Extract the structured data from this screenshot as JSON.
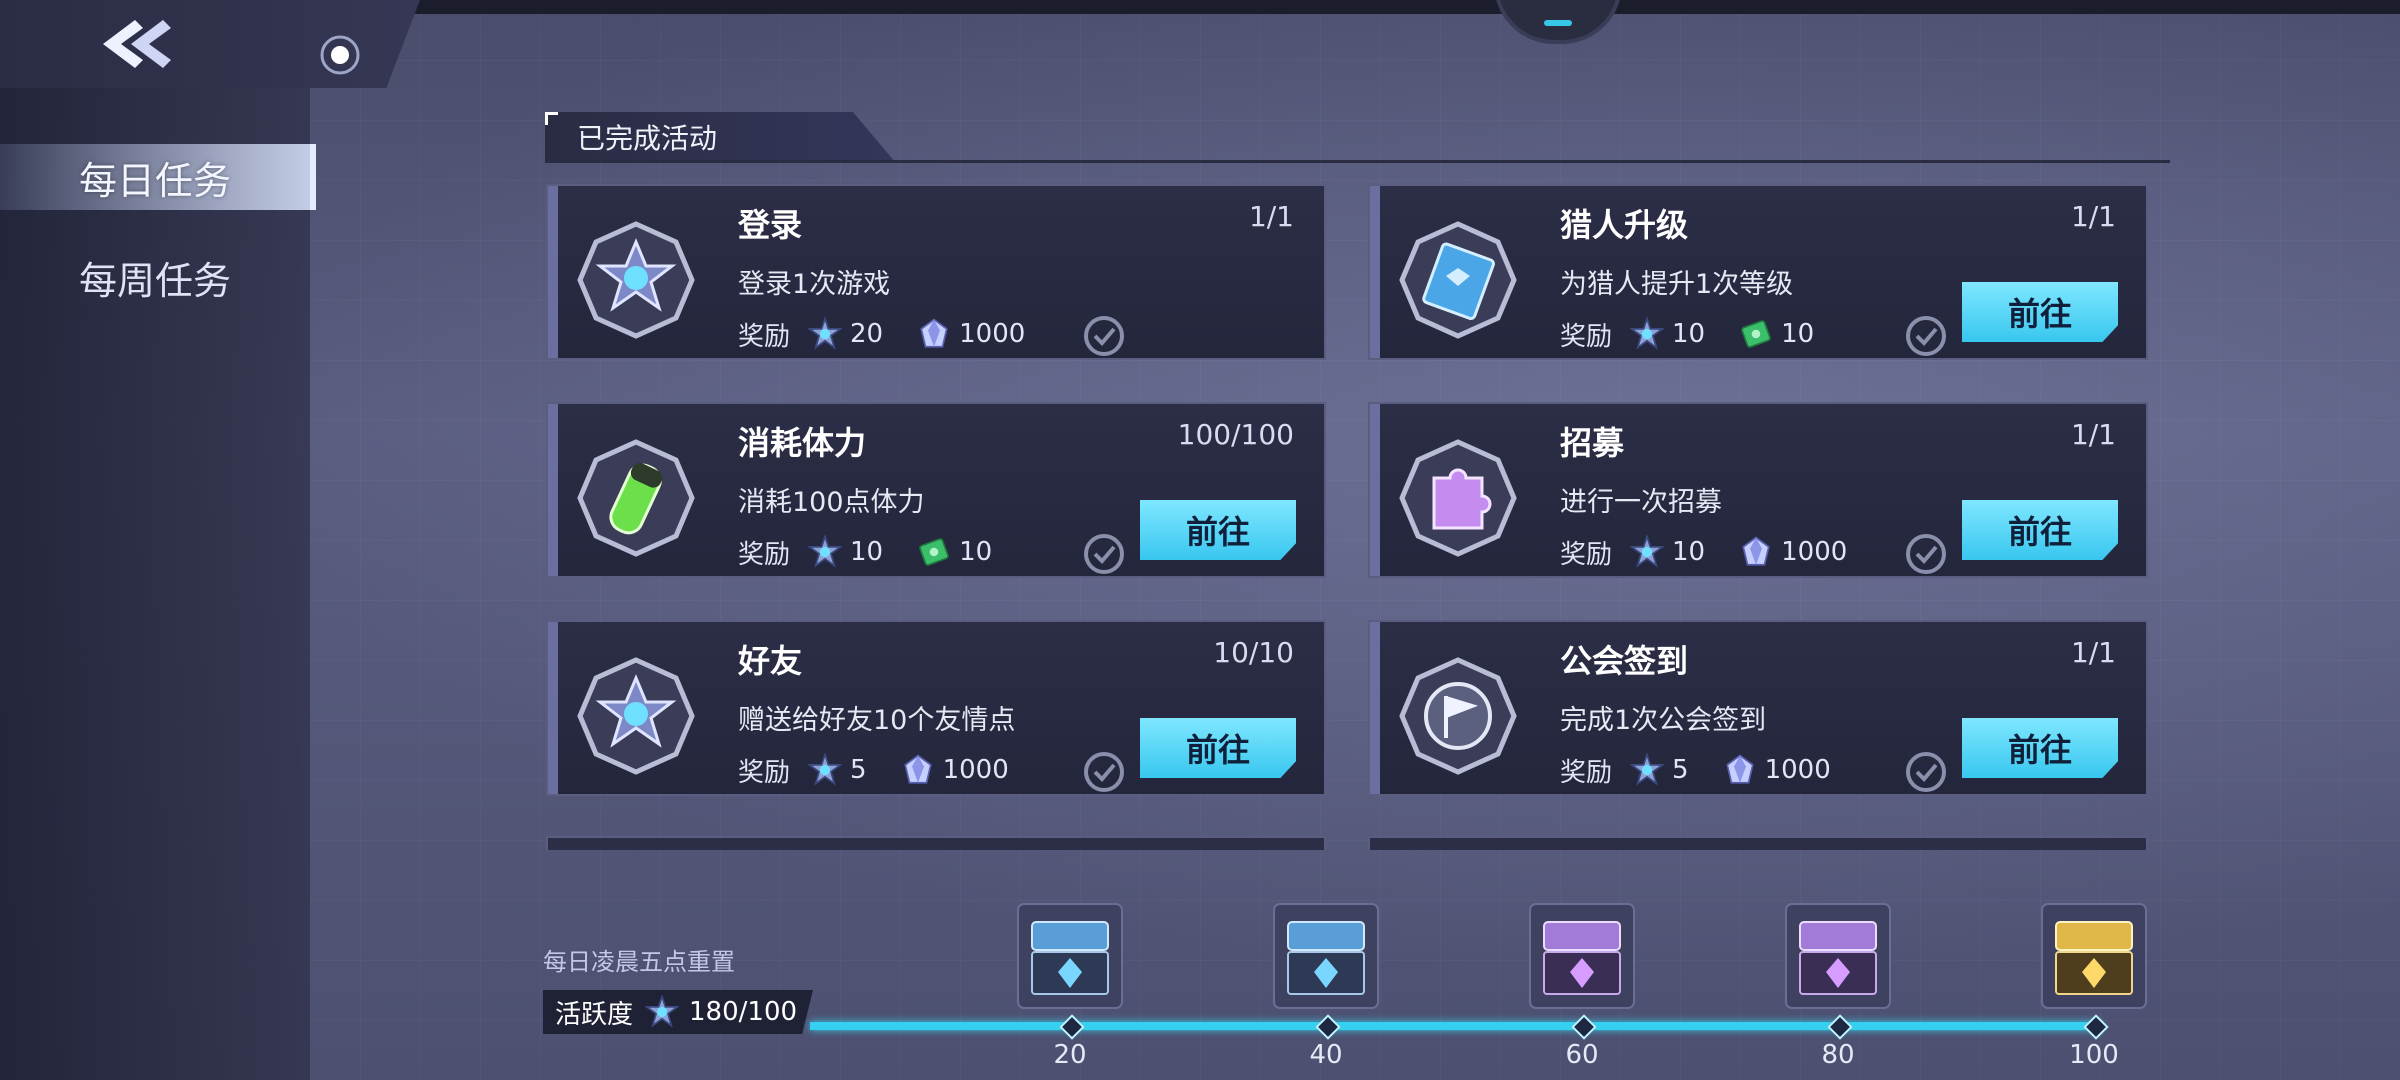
{
  "section_title": "已完成活动",
  "sidebar": {
    "items": [
      {
        "label": "每日任务",
        "active": true
      },
      {
        "label": "每周任务",
        "active": false
      }
    ]
  },
  "reward_label": "奖励",
  "go_label": "前往",
  "tasks": [
    {
      "title": "登录",
      "count": "1/1",
      "desc": "登录1次游戏",
      "icon": "emblem-icon",
      "rewards": [
        {
          "icon": "activity-point-icon",
          "amount": "20"
        },
        {
          "icon": "crystal-icon",
          "amount": "1000"
        }
      ],
      "has_go": false
    },
    {
      "title": "猎人升级",
      "count": "1/1",
      "desc": "为猎人提升1次等级",
      "icon": "blue-book-icon",
      "rewards": [
        {
          "icon": "activity-point-icon",
          "amount": "10"
        },
        {
          "icon": "green-ticket-icon",
          "amount": "10"
        }
      ],
      "has_go": true
    },
    {
      "title": "消耗体力",
      "count": "100/100",
      "desc": "消耗100点体力",
      "icon": "stamina-vial-icon",
      "rewards": [
        {
          "icon": "activity-point-icon",
          "amount": "10"
        },
        {
          "icon": "green-ticket-icon",
          "amount": "10"
        }
      ],
      "has_go": true
    },
    {
      "title": "招募",
      "count": "1/1",
      "desc": "进行一次招募",
      "icon": "recruit-puzzle-icon",
      "rewards": [
        {
          "icon": "activity-point-icon",
          "amount": "10"
        },
        {
          "icon": "crystal-icon",
          "amount": "1000"
        }
      ],
      "has_go": true
    },
    {
      "title": "好友",
      "count": "10/10",
      "desc": "赠送给好友10个友情点",
      "icon": "emblem-icon",
      "rewards": [
        {
          "icon": "activity-point-icon",
          "amount": "5"
        },
        {
          "icon": "crystal-icon",
          "amount": "1000"
        }
      ],
      "has_go": true
    },
    {
      "title": "公会签到",
      "count": "1/1",
      "desc": "完成1次公会签到",
      "icon": "guild-flag-icon",
      "rewards": [
        {
          "icon": "activity-point-icon",
          "amount": "5"
        },
        {
          "icon": "crystal-icon",
          "amount": "1000"
        }
      ],
      "has_go": true
    }
  ],
  "reset_note": "每日凌晨五点重置",
  "activity": {
    "label": "活跃度",
    "value": "180/100",
    "progress_fraction": 1.0
  },
  "milestones": [
    {
      "value": "20",
      "chest": "blue-chest-icon"
    },
    {
      "value": "40",
      "chest": "blue-chest-icon"
    },
    {
      "value": "60",
      "chest": "purple-chest-icon"
    },
    {
      "value": "80",
      "chest": "purple-chest-icon"
    },
    {
      "value": "100",
      "chest": "gold-chest-icon"
    }
  ],
  "colors": {
    "accent": "#38c7ef",
    "card_bg": "#2c2e47",
    "go_button": "#7fe7ff"
  }
}
